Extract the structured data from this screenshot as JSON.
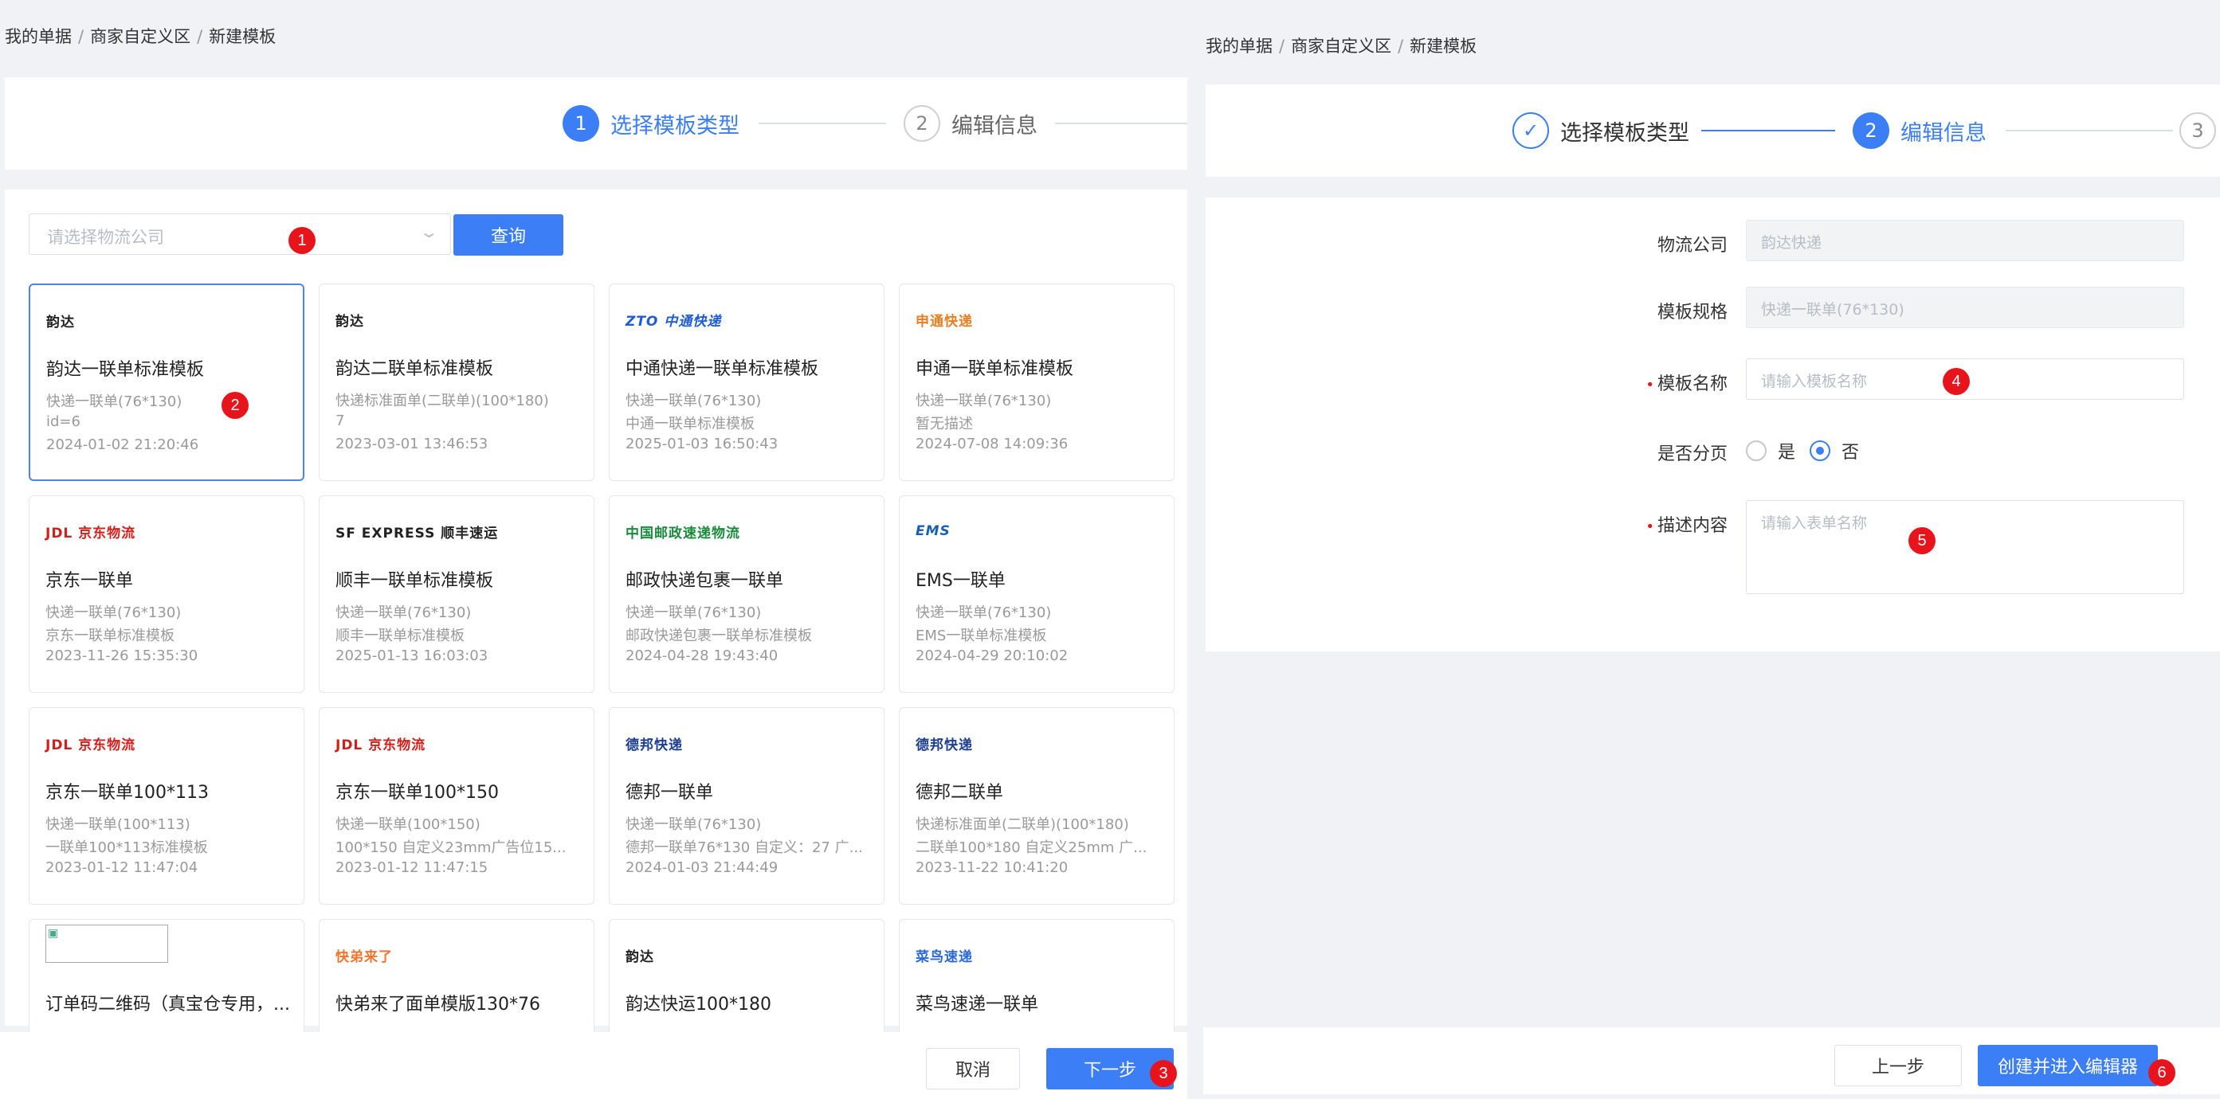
{
  "colors": {
    "accent": "#3b7ef5",
    "badge": "#e8141c"
  },
  "left": {
    "breadcrumb": [
      "我的单据",
      "商家自定义区",
      "新建模板"
    ],
    "steps": [
      {
        "num": "1",
        "label": "选择模板类型"
      },
      {
        "num": "2",
        "label": "编辑信息"
      }
    ],
    "select_placeholder": "请选择物流公司",
    "query_label": "查询",
    "templates": [
      {
        "logo": "韵达",
        "logo_icon": "yunda-logo",
        "name": "韵达一联单标准模板",
        "spec": "快递一联单(76*130)",
        "desc": "id=6",
        "time": "2024-01-02 21:20:46"
      },
      {
        "logo": "韵达",
        "logo_icon": "yunda-logo",
        "name": "韵达二联单标准模板",
        "spec": "快递标准面单(二联单)(100*180)",
        "desc": "7",
        "time": "2023-03-01 13:46:53"
      },
      {
        "logo": "ZTO 中通快递",
        "logo_icon": "zto-logo",
        "name": "中通快递一联单标准模板",
        "spec": "快递一联单(76*130)",
        "desc": "中通一联单标准模板",
        "time": "2025-01-03 16:50:43"
      },
      {
        "logo": "申通快递",
        "logo_icon": "sto-logo",
        "name": "申通一联单标准模板",
        "spec": "快递一联单(76*130)",
        "desc": "暂无描述",
        "time": "2024-07-08 14:09:36"
      },
      {
        "logo": "JDL 京东物流",
        "logo_icon": "jdl-logo",
        "name": "京东一联单",
        "spec": "快递一联单(76*130)",
        "desc": "京东一联单标准模板",
        "time": "2023-11-26 15:35:30"
      },
      {
        "logo": "SF EXPRESS 顺丰速运",
        "logo_icon": "sf-logo",
        "name": "顺丰一联单标准模板",
        "spec": "快递一联单(76*130)",
        "desc": "顺丰一联单标准模板",
        "time": "2025-01-13 16:03:03"
      },
      {
        "logo": "中国邮政速递物流",
        "logo_icon": "post-logo",
        "name": "邮政快递包裹一联单",
        "spec": "快递一联单(76*130)",
        "desc": "邮政快递包裹一联单标准模板",
        "time": "2024-04-28 19:43:40"
      },
      {
        "logo": "EMS",
        "logo_icon": "ems-logo",
        "name": "EMS一联单",
        "spec": "快递一联单(76*130)",
        "desc": "EMS一联单标准模板",
        "time": "2024-04-29 20:10:02"
      },
      {
        "logo": "JDL 京东物流",
        "logo_icon": "jdl-logo",
        "name": "京东一联单100*113",
        "spec": "快递一联单(100*113)",
        "desc": "一联单100*113标准模板",
        "time": "2023-01-12 11:47:04"
      },
      {
        "logo": "JDL 京东物流",
        "logo_icon": "jdl-logo",
        "name": "京东一联单100*150",
        "spec": "快递一联单(100*150)",
        "desc": "100*150 自定义23mm广告位15...",
        "time": "2023-01-12 11:47:15"
      },
      {
        "logo": "德邦快递",
        "logo_icon": "deppon-logo",
        "name": "德邦一联单",
        "spec": "快递一联单(76*130)",
        "desc": "德邦一联单76*130 自定义：27 广...",
        "time": "2024-01-03 21:44:49"
      },
      {
        "logo": "德邦快递",
        "logo_icon": "deppon-logo",
        "name": "德邦二联单",
        "spec": "快递标准面单(二联单)(100*180)",
        "desc": "二联单100*180 自定义25mm 广...",
        "time": "2023-11-22 10:41:20"
      },
      {
        "logo": "",
        "logo_icon": "broken-image-icon",
        "name": "订单码二维码（真宝仓专用，...",
        "spec": "",
        "desc": "",
        "time": ""
      },
      {
        "logo": "快弟来了",
        "logo_icon": "kuaidi-logo",
        "name": "快弟来了面单模版130*76",
        "spec": "",
        "desc": "",
        "time": ""
      },
      {
        "logo": "韵达",
        "logo_icon": "yunda-logo",
        "name": "韵达快运100*180",
        "spec": "",
        "desc": "",
        "time": ""
      },
      {
        "logo": "菜鸟速递",
        "logo_icon": "cainiao-logo",
        "name": "菜鸟速递一联单",
        "spec": "",
        "desc": "",
        "time": ""
      }
    ],
    "cancel_label": "取消",
    "next_label": "下一步"
  },
  "right": {
    "breadcrumb": [
      "我的单据",
      "商家自定义区",
      "新建模板"
    ],
    "steps": [
      {
        "num": "✓",
        "label": "选择模板类型"
      },
      {
        "num": "2",
        "label": "编辑信息"
      },
      {
        "num": "3",
        "label": ""
      }
    ],
    "fields": {
      "company_label": "物流公司",
      "company_value": "韵达快递",
      "spec_label": "模板规格",
      "spec_value": "快递一联单(76*130)",
      "name_label": "模板名称",
      "name_placeholder": "请输入模板名称",
      "paging_label": "是否分页",
      "paging_yes": "是",
      "paging_no": "否",
      "paging_selected": "否",
      "desc_label": "描述内容",
      "desc_placeholder": "请输入表单名称"
    },
    "prev_label": "上一步",
    "create_label": "创建并进入编辑器"
  },
  "badges": [
    "1",
    "2",
    "3",
    "4",
    "5",
    "6"
  ]
}
